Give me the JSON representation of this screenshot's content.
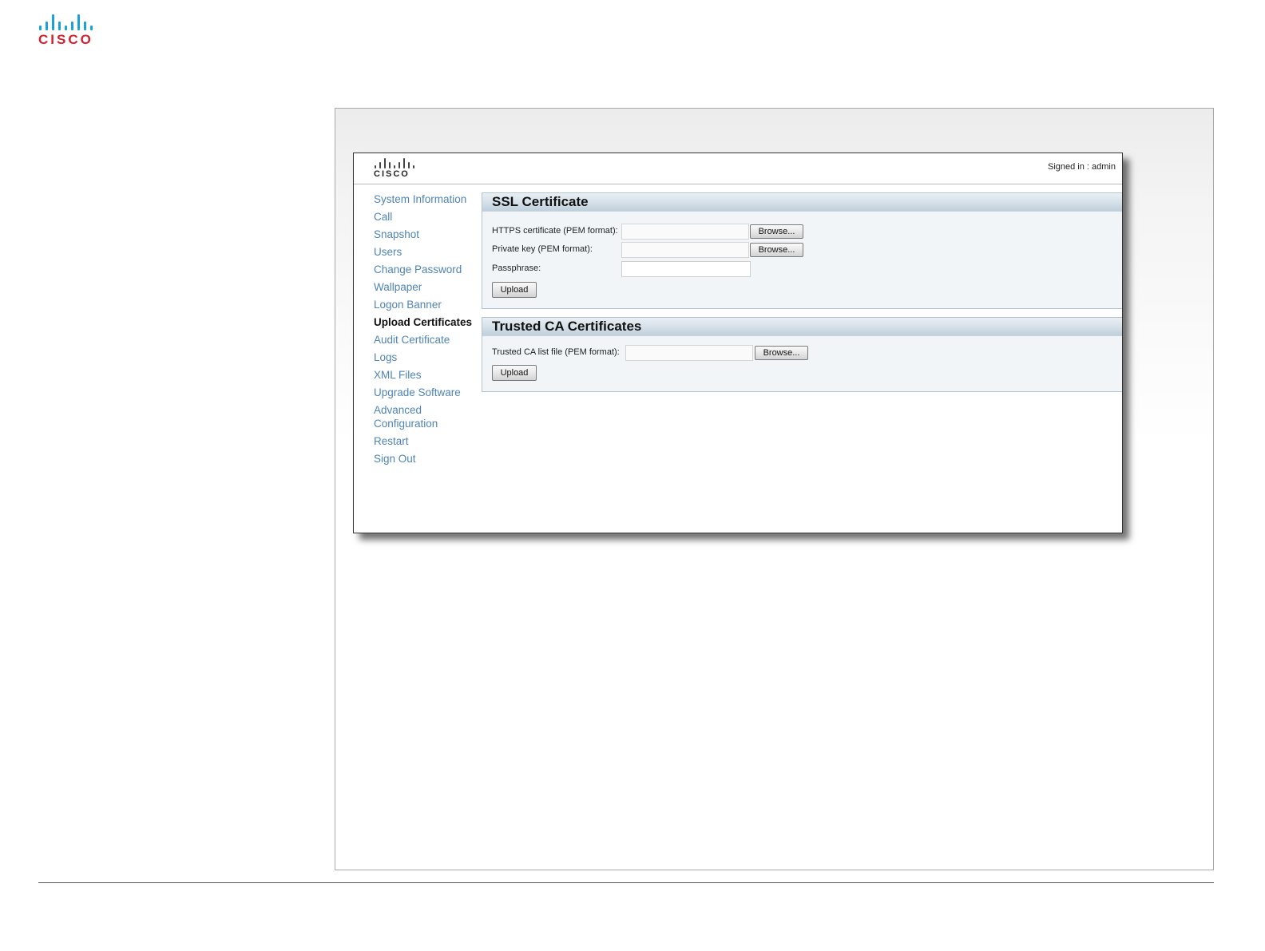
{
  "brand": {
    "logo_word": "CISCO",
    "logo_icon": "cisco-bars-icon"
  },
  "window": {
    "logo_word": "CISCO",
    "signed_in": "Signed in : admin"
  },
  "nav": {
    "items": [
      {
        "label": "System Information"
      },
      {
        "label": "Call"
      },
      {
        "label": "Snapshot"
      },
      {
        "label": "Users"
      },
      {
        "label": "Change Password"
      },
      {
        "label": "Wallpaper"
      },
      {
        "label": "Logon Banner"
      },
      {
        "label": "Upload Certificates",
        "active": true
      },
      {
        "label": "Audit Certificate"
      },
      {
        "label": "Logs"
      },
      {
        "label": "XML Files"
      },
      {
        "label": "Upgrade Software"
      },
      {
        "label": "Advanced Configuration"
      },
      {
        "label": "Restart"
      },
      {
        "label": "Sign Out"
      }
    ]
  },
  "ssl": {
    "title": "SSL Certificate",
    "https_label": "HTTPS certificate (PEM format):",
    "https_value": "",
    "private_key_label": "Private key (PEM format):",
    "private_key_value": "",
    "passphrase_label": "Passphrase:",
    "passphrase_value": "",
    "browse_label": "Browse...",
    "upload_label": "Upload"
  },
  "trusted": {
    "title": "Trusted CA Certificates",
    "list_label": "Trusted CA list file (PEM format):",
    "list_value": "",
    "browse_label": "Browse...",
    "upload_label": "Upload"
  },
  "colors": {
    "logo_blue": "#1ba0d7",
    "logo_red": "#d1202f",
    "nav_link": "#4f84b4",
    "section_header": "#bfcfdb"
  }
}
